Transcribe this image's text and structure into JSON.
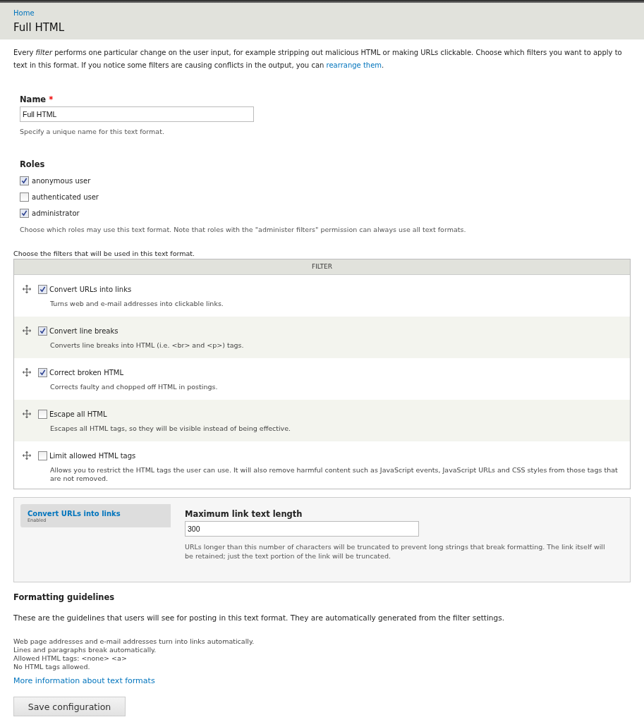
{
  "breadcrumb": "Home",
  "page_title": "Full HTML",
  "intro": {
    "text": "Every *filter* performs one particular change on the user input, for example stripping out malicious HTML or making URLs clickable. Choose which filters you want to apply to text in this format. If you notice some filters are causing conflicts in the output, you can",
    "link": "rearrange them",
    "after": "."
  },
  "name_field": {
    "label": "Name",
    "required_mark": "*",
    "value": "Full HTML",
    "description": "Specify a unique name for this text format."
  },
  "roles": {
    "label": "Roles",
    "items": [
      {
        "label": "anonymous user",
        "checked": true
      },
      {
        "label": "authenticated user",
        "checked": false
      },
      {
        "label": "administrator",
        "checked": true
      }
    ],
    "description": "Choose which roles may use this text format. Note that roles with the \"administer filters\" permission can always use all text formats."
  },
  "filters_caption": "Choose the filters that will be used in this text format.",
  "filter_table": {
    "header": "FILTER",
    "rows": [
      {
        "label": "Convert URLs into links",
        "checked": true,
        "description": "Turns web and e-mail addresses into clickable links."
      },
      {
        "label": "Convert line breaks",
        "checked": true,
        "description": "Converts line breaks into HTML (i.e. <br> and <p>) tags."
      },
      {
        "label": "Correct broken HTML",
        "checked": true,
        "description": "Corrects faulty and chopped off HTML in postings."
      },
      {
        "label": "Escape all HTML",
        "checked": false,
        "description": "Escapes all HTML tags, so they will be visible instead of being effective."
      },
      {
        "label": "Limit allowed HTML tags",
        "checked": false,
        "description": "Allows you to restrict the HTML tags the user can use. It will also remove harmful content such as JavaScript events, JavaScript URLs and CSS styles from those tags that are not removed."
      }
    ]
  },
  "settings": {
    "tabs": [
      {
        "title": "Convert URLs into links",
        "summary": "Enabled",
        "selected": true
      }
    ],
    "field": {
      "label": "Maximum link text length",
      "value": "300",
      "description": "URLs longer than this number of characters will be truncated to prevent long strings that break formatting. The link itself will be retained; just the text portion of the link will be truncated."
    }
  },
  "guidelines": {
    "title": "Formatting guidelines",
    "description": "These are the guidelines that users will see for posting in this text format. They are automatically generated from the filter settings.",
    "tips": [
      "Web page addresses and e-mail addresses turn into links automatically.",
      "Lines and paragraphs break automatically.",
      "Allowed HTML tags: <none> <a>",
      "No HTML tags allowed."
    ],
    "link": "More information about text formats"
  },
  "save_button": "Save configuration"
}
